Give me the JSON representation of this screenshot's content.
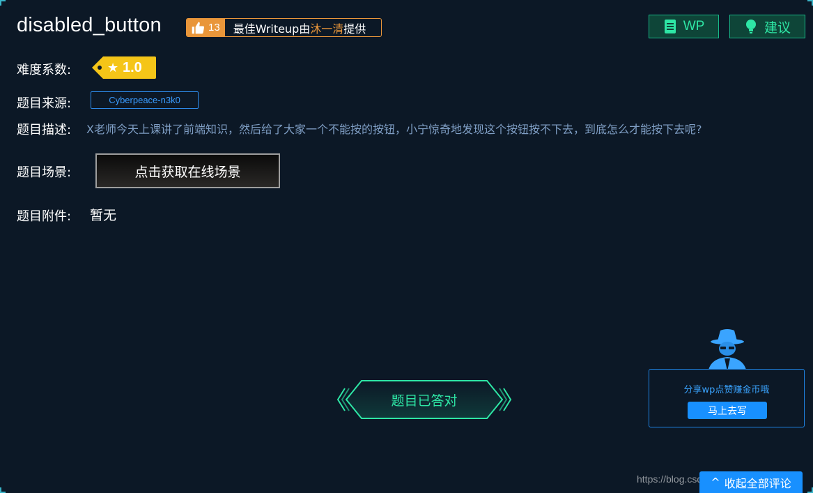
{
  "title": "disabled_button",
  "writeup_badge": {
    "likes": "13",
    "text_prefix": "最佳Writeup由",
    "author": "沐一清",
    "text_suffix": "提供"
  },
  "top_buttons": {
    "wp_label": "WP",
    "suggest_label": "建议"
  },
  "difficulty": {
    "label": "难度系数:",
    "value": "1.0"
  },
  "source": {
    "label": "题目来源:",
    "value": "Cyberpeace-n3k0"
  },
  "description": {
    "label": "题目描述:",
    "value": "X老师今天上课讲了前端知识，然后给了大家一个不能按的按钮，小宁惊奇地发现这个按钮按不下去，到底怎么才能按下去呢?"
  },
  "scene": {
    "label": "题目场景:",
    "button_label": "点击获取在线场景"
  },
  "attachment": {
    "label": "题目附件:",
    "value": "暂无"
  },
  "answered_label": "题目已答对",
  "share": {
    "text": "分享wp点赞赚金币哦",
    "button_label": "马上去写"
  },
  "collapse_label": "收起全部评论",
  "watermark": "https://blog.csdn.net/qq_43660394",
  "colors": {
    "background": "#0c1826",
    "accent_green": "#2ee6a5",
    "accent_blue": "#1890ff",
    "accent_orange": "#e9963a",
    "difficulty_yellow": "#f5c518"
  },
  "icons": {
    "like": "thumbs-up-icon",
    "wp": "document-icon",
    "suggest": "lightbulb-icon",
    "star": "star-icon",
    "collapse": "chevron-up-icon",
    "avatar": "spy-icon"
  }
}
